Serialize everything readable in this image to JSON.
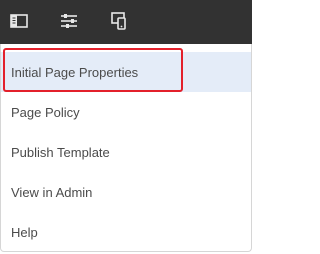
{
  "toolbar": {
    "buttons": [
      {
        "icon": "side-panel-icon"
      },
      {
        "icon": "sliders-icon"
      },
      {
        "icon": "device-preview-icon"
      }
    ],
    "background": "#323232",
    "icon_color": "#e8e8e8"
  },
  "menu": {
    "items": [
      {
        "label": "Initial Page Properties",
        "selected": true
      },
      {
        "label": "Page Policy"
      },
      {
        "label": "Publish Template"
      },
      {
        "label": "View in Admin"
      },
      {
        "label": "Help"
      }
    ],
    "selected_background": "#e4ecf8",
    "text_color": "#4b4b4b"
  },
  "annotation": {
    "highlight_color": "#e3202b"
  }
}
